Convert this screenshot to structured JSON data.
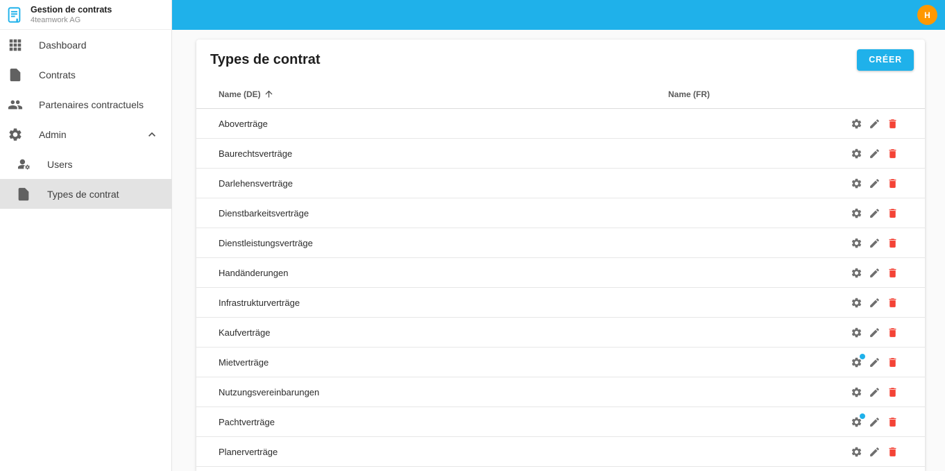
{
  "app": {
    "title": "Gestion de contrats",
    "subtitle": "4teamwork AG",
    "logo_icon": "contract-document-icon"
  },
  "topbar": {
    "avatar_initial": "H"
  },
  "sidebar": {
    "items": [
      {
        "label": "Dashboard",
        "icon": "apps-icon"
      },
      {
        "label": "Contrats",
        "icon": "document-icon"
      },
      {
        "label": "Partenaires contractuels",
        "icon": "people-icon"
      },
      {
        "label": "Admin",
        "icon": "gear-icon",
        "expanded": true,
        "chevron_icon": "chevron-up-icon"
      },
      {
        "label": "Users",
        "icon": "user-gear-icon",
        "indent": true
      },
      {
        "label": "Types de contrat",
        "icon": "document-icon",
        "indent": true,
        "selected": true
      }
    ]
  },
  "main": {
    "title": "Types de contrat",
    "create_button_label": "CRÉER",
    "table": {
      "columns": [
        {
          "label": "Name (DE)",
          "sorted": "asc",
          "sort_icon": "arrow-upward-icon"
        },
        {
          "label": "Name (FR)"
        }
      ],
      "row_action_icons": [
        "gear-icon",
        "pencil-icon",
        "delete-icon"
      ],
      "rows": [
        {
          "name_de": "Aboverträge",
          "name_fr": "",
          "settings_badge": false
        },
        {
          "name_de": "Baurechtsverträge",
          "name_fr": "",
          "settings_badge": false
        },
        {
          "name_de": "Darlehensverträge",
          "name_fr": "",
          "settings_badge": false
        },
        {
          "name_de": "Dienstbarkeitsverträge",
          "name_fr": "",
          "settings_badge": false
        },
        {
          "name_de": "Dienstleistungsverträge",
          "name_fr": "",
          "settings_badge": false
        },
        {
          "name_de": "Handänderungen",
          "name_fr": "",
          "settings_badge": false
        },
        {
          "name_de": "Infrastrukturverträge",
          "name_fr": "",
          "settings_badge": false
        },
        {
          "name_de": "Kaufverträge",
          "name_fr": "",
          "settings_badge": false
        },
        {
          "name_de": "Mietverträge",
          "name_fr": "",
          "settings_badge": true
        },
        {
          "name_de": "Nutzungsvereinbarungen",
          "name_fr": "",
          "settings_badge": false
        },
        {
          "name_de": "Pachtverträge",
          "name_fr": "",
          "settings_badge": true
        },
        {
          "name_de": "Planerverträge",
          "name_fr": "",
          "settings_badge": false
        }
      ]
    }
  },
  "colors": {
    "accent": "#1fb1ea",
    "avatar_bg": "#ff9800",
    "delete": "#f44336"
  }
}
